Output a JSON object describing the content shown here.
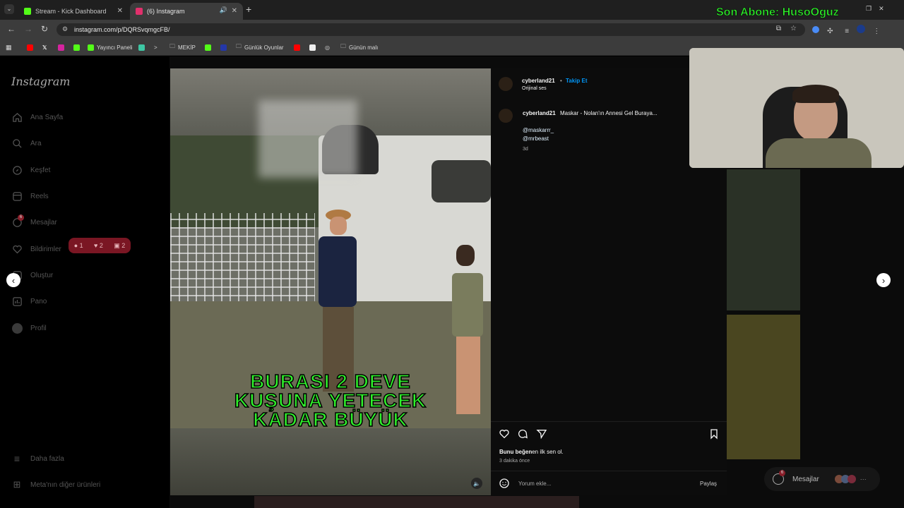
{
  "browser": {
    "tabs": [
      {
        "label": "Stream - Kick Dashboard",
        "active": false
      },
      {
        "label": "(6) Instagram",
        "active": true
      }
    ],
    "url": "instagram.com/p/DQRSvqmgcFB/",
    "bookmarks": [
      "Yayıncı Paneli",
      "MEKİP",
      "Günlük Oyunlar",
      "Günün malı"
    ]
  },
  "stream_overlay": {
    "subscriber_text": "Son Abone: HusoOguz"
  },
  "sidebar": {
    "logo": "Instagram",
    "items": [
      {
        "label": "Ana Sayfa",
        "icon": "home-icon"
      },
      {
        "label": "Ara",
        "icon": "search-icon"
      },
      {
        "label": "Keşfet",
        "icon": "compass-icon"
      },
      {
        "label": "Reels",
        "icon": "reels-icon"
      },
      {
        "label": "Mesajlar",
        "icon": "messenger-icon",
        "badge": "6"
      },
      {
        "label": "Bildirimler",
        "icon": "heart-icon"
      },
      {
        "label": "Oluştur",
        "icon": "plus-icon"
      },
      {
        "label": "Pano",
        "icon": "dashboard-icon"
      },
      {
        "label": "Profil",
        "icon": "profile-icon"
      }
    ],
    "more": "Daha fazla",
    "meta": "Meta'nın diğer ürünleri",
    "notification_popup": {
      "comments": "1",
      "likes": "2",
      "follows": "2"
    }
  },
  "post": {
    "author": "cyberland21",
    "follow": "Takip Et",
    "audio": "Orijinal ses",
    "caption_author": "cyberland21",
    "caption": "Maskar - Nolan'ın Annesi Gel Buraya...",
    "mentions": [
      "@maskarrr_",
      "@mrbeast"
    ],
    "caption_age": "3d",
    "likes_bold": "Bunu beğen",
    "likes_rest": "en ilk sen ol.",
    "time": "3 dakika önce",
    "comment_placeholder": "Yorum ekle...",
    "share": "Paylaş",
    "video_caption": [
      "BURASI 2 DEVE",
      "KUŞUNA YETECEK",
      "KADAR BÜYÜK"
    ]
  },
  "messages_bar": {
    "label": "Mesajlar",
    "badge": "6"
  },
  "colors": {
    "accent": "#0095f6",
    "caption_green": "#2ff12b",
    "badge_red": "#ff3040"
  }
}
